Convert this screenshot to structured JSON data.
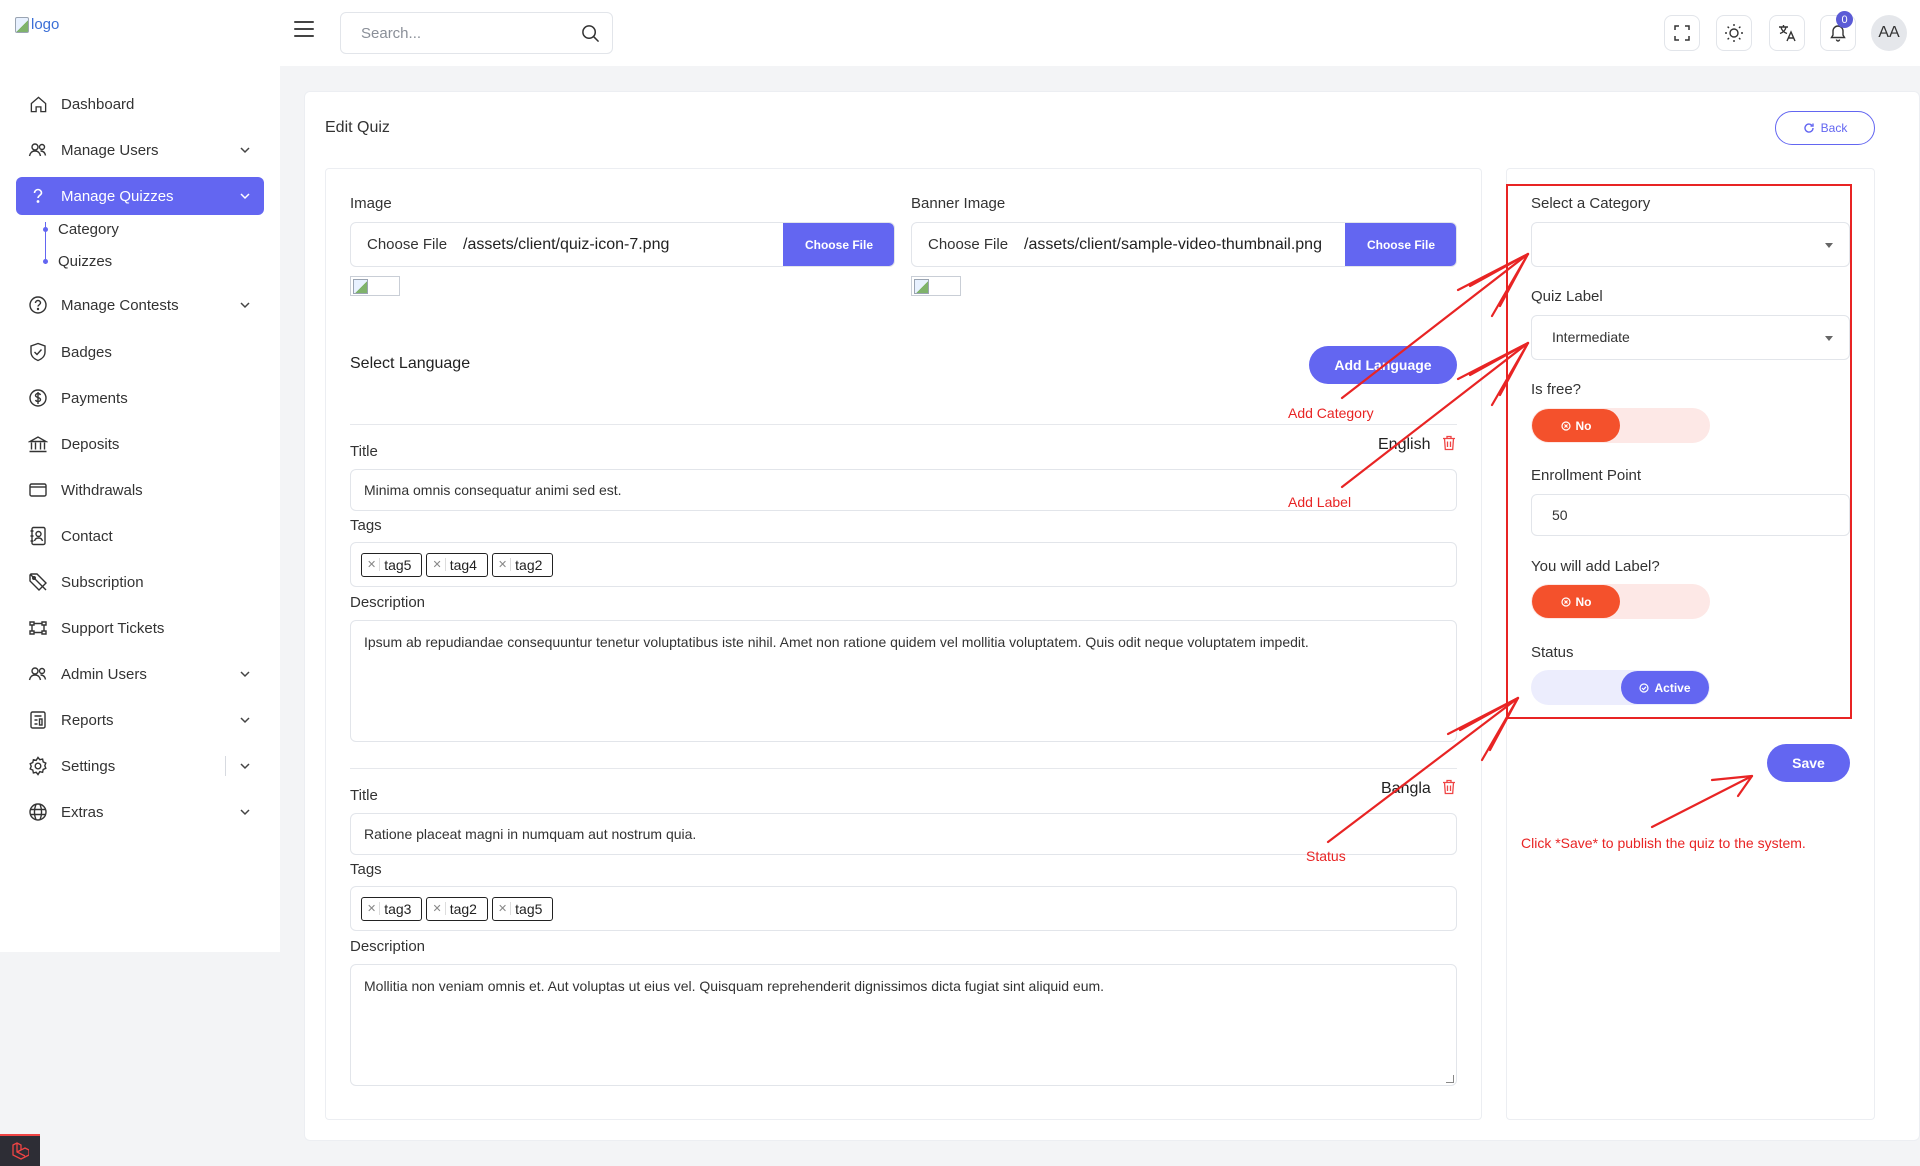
{
  "topbar": {
    "logo_alt": "logo",
    "search_placeholder": "Search...",
    "notification_count": "0",
    "avatar_initials": "AA"
  },
  "sidebar": {
    "items": [
      {
        "label": "Dashboard",
        "icon": "home-icon",
        "has_chevron": false
      },
      {
        "label": "Manage Users",
        "icon": "users-icon",
        "has_chevron": true
      },
      {
        "label": "Manage Quizzes",
        "icon": "question-icon",
        "has_chevron": true,
        "active": true
      },
      {
        "label": "Manage Contests",
        "icon": "contest-icon",
        "has_chevron": true
      },
      {
        "label": "Badges",
        "icon": "shield-check-icon",
        "has_chevron": false
      },
      {
        "label": "Payments",
        "icon": "dollar-icon",
        "has_chevron": false
      },
      {
        "label": "Deposits",
        "icon": "bank-icon",
        "has_chevron": false
      },
      {
        "label": "Withdrawals",
        "icon": "wallet-icon",
        "has_chevron": false
      },
      {
        "label": "Contact",
        "icon": "contact-book-icon",
        "has_chevron": false
      },
      {
        "label": "Subscription",
        "icon": "subscription-icon",
        "has_chevron": false
      },
      {
        "label": "Support Tickets",
        "icon": "ticket-icon",
        "has_chevron": false
      },
      {
        "label": "Admin Users",
        "icon": "admin-users-icon",
        "has_chevron": true
      },
      {
        "label": "Reports",
        "icon": "report-icon",
        "has_chevron": true
      },
      {
        "label": "Settings",
        "icon": "gear-icon",
        "has_chevron": true
      },
      {
        "label": "Extras",
        "icon": "extras-icon",
        "has_chevron": true
      }
    ],
    "sub_items": [
      "Category",
      "Quizzes"
    ]
  },
  "page": {
    "title": "Edit Quiz",
    "back_label": "Back"
  },
  "form": {
    "image_label": "Image",
    "image_choose": "Choose File",
    "image_file": "/assets/client/quiz-icon-7.png",
    "image_button": "Choose File",
    "banner_label": "Banner Image",
    "banner_choose": "Choose File",
    "banner_file": "/assets/client/sample-video-thumbnail.png",
    "banner_button": "Choose File",
    "select_language": "Select Language",
    "add_language": "Add Language",
    "languages": [
      {
        "name": "English",
        "title_label": "Title",
        "title": "Minima omnis consequatur animi sed est.",
        "tags_label": "Tags",
        "tags": [
          "tag5",
          "tag4",
          "tag2"
        ],
        "description_label": "Description",
        "description": "Ipsum ab repudiandae consequuntur tenetur voluptatibus iste nihil. Amet non ratione quidem vel mollitia voluptatem. Quis odit neque voluptatem impedit."
      },
      {
        "name": "Bangla",
        "title_label": "Title",
        "title": "Ratione placeat magni in numquam aut nostrum quia.",
        "tags_label": "Tags",
        "tags": [
          "tag3",
          "tag2",
          "tag5"
        ],
        "description_label": "Description",
        "description": "Mollitia non veniam omnis et. Aut voluptas ut eius vel. Quisquam reprehenderit dignissimos dicta fugiat sint aliquid eum."
      }
    ]
  },
  "settings": {
    "category_label": "Select a Category",
    "category_value": "",
    "quiz_label_label": "Quiz Label",
    "quiz_label_value": "Intermediate",
    "is_free_label": "Is free?",
    "is_free_value": "No",
    "enrollment_label": "Enrollment Point",
    "enrollment_value": "50",
    "add_label_label": "You will add Label?",
    "add_label_value": "No",
    "status_label": "Status",
    "status_value": "Active",
    "save_label": "Save"
  },
  "annotations": {
    "add_category": "Add Category",
    "add_label": "Add Label",
    "status": "Status",
    "save_hint": "Click *Save* to publish the quiz to the system."
  },
  "colors": {
    "primary": "#6366f1",
    "danger": "#f4512c",
    "annotation": "#e82424"
  }
}
